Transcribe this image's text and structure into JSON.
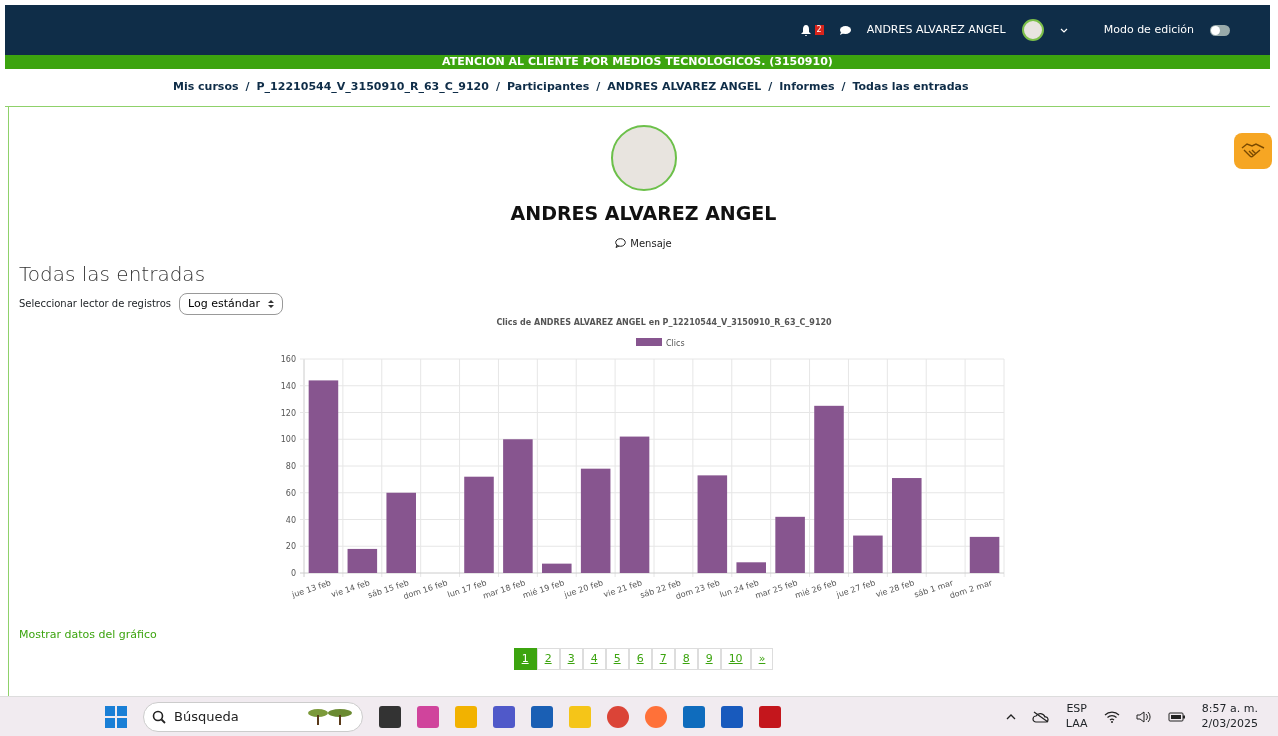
{
  "navbar": {
    "notification_count": "2",
    "user_name": "ANDRES ALVAREZ ANGEL",
    "edit_mode_label": "Modo de edición",
    "edit_mode_on": false
  },
  "course_banner": "ATENCION AL CLIENTE POR MEDIOS TECNOLOGICOS. (3150910)",
  "breadcrumb": [
    {
      "label": "Mis cursos"
    },
    {
      "separator": "/",
      "label": "P_12210544_V_3150910_R_63_C_9120"
    },
    {
      "separator": "/",
      "label": "Participantes"
    },
    {
      "separator": "/",
      "label": "ANDRES ALVAREZ ANGEL"
    },
    {
      "separator": "/",
      "label": "Informes"
    },
    {
      "separator": "/",
      "label": "Todas las entradas"
    }
  ],
  "profile": {
    "name": "ANDRES ALVAREZ ANGEL",
    "message_label": "Mensaje"
  },
  "heading": "Todas las entradas",
  "log_reader": {
    "label": "Seleccionar lector de registros",
    "value": "Log estándar"
  },
  "chart_data": {
    "type": "bar",
    "title": "Clics de ANDRES ALVAREZ ANGEL  en P_12210544_V_3150910_R_63_C_9120",
    "categories": [
      "jue 13 feb",
      "vie 14 feb",
      "sáb 15 feb",
      "dom 16 feb",
      "lun 17 feb",
      "mar 18 feb",
      "mié 19 feb",
      "jue 20 feb",
      "vie 21 feb",
      "sáb 22 feb",
      "dom 23 feb",
      "lun 24 feb",
      "mar 25 feb",
      "mié 26 feb",
      "jue 27 feb",
      "vie 28 feb",
      "sáb 1 mar",
      "dom 2 mar"
    ],
    "series": [
      {
        "name": "Clics",
        "color": "#87558f",
        "values": [
          144,
          18,
          60,
          0,
          72,
          100,
          7,
          78,
          102,
          0,
          73,
          8,
          42,
          125,
          28,
          71,
          0,
          27
        ]
      }
    ],
    "ylim": [
      0,
      160
    ],
    "grid": true,
    "yticks": [
      0,
      20,
      40,
      60,
      80,
      100,
      120,
      140,
      160
    ]
  },
  "show_data_link": "Mostrar datos del gráfico",
  "pagination": [
    {
      "label": "1",
      "selected": true
    },
    {
      "label": "2",
      "selected": false
    },
    {
      "label": "3",
      "selected": false
    },
    {
      "label": "4",
      "selected": false
    },
    {
      "label": "5",
      "selected": false
    },
    {
      "label": "6",
      "selected": false
    },
    {
      "label": "7",
      "selected": false
    },
    {
      "label": "8",
      "selected": false
    },
    {
      "label": "9",
      "selected": false
    },
    {
      "label": "10",
      "selected": false
    },
    {
      "label": "»",
      "selected": false
    }
  ],
  "taskbar": {
    "search_placeholder": "Búsqueda",
    "language": "ESP",
    "layout": "LAA",
    "time": "8:57 a. m.",
    "date": "2/03/2025"
  }
}
